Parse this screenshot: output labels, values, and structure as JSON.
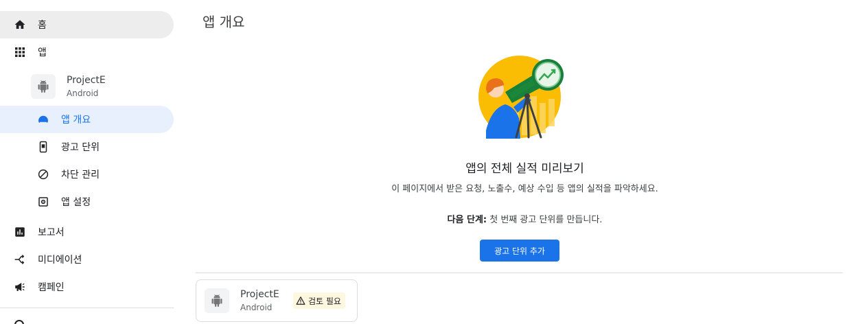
{
  "sidebar": {
    "items": [
      {
        "label": "홈",
        "icon": "home-icon"
      },
      {
        "label": "앱",
        "icon": "apps-grid-icon"
      }
    ],
    "app_entry": {
      "name": "ProjectE",
      "platform": "Android",
      "icon": "android-icon"
    },
    "sub_items": [
      {
        "label": "앱 개요",
        "icon": "speedometer-icon"
      },
      {
        "label": "광고 단위",
        "icon": "phone-icon"
      },
      {
        "label": "차단 관리",
        "icon": "block-icon"
      },
      {
        "label": "앱 설정",
        "icon": "settings-icon"
      }
    ],
    "bottom_items": [
      {
        "label": "보고서",
        "icon": "reports-icon"
      },
      {
        "label": "미디에이션",
        "icon": "mediation-icon"
      },
      {
        "label": "캠페인",
        "icon": "megaphone-icon"
      }
    ]
  },
  "main": {
    "title": "앱 개요",
    "hero": {
      "heading": "앱의 전체 실적 미리보기",
      "description": "이 페이지에서 받은 요청, 노출수, 예상 수입 등 앱의 실적을 파악하세요.",
      "next_step_label": "다음 단계:",
      "next_step_text": " 첫 번째 광고 단위를 만듭니다.",
      "button_label": "광고 단위 추가"
    },
    "app_card": {
      "name": "ProjectE",
      "platform": "Android",
      "badge": "검토 필요",
      "badge_icon": "warning-icon"
    }
  },
  "colors": {
    "accent": "#1a73e8",
    "active_bg": "#e8f0fe",
    "home_bg": "#ededed",
    "badge_bg": "#fef7e0"
  }
}
